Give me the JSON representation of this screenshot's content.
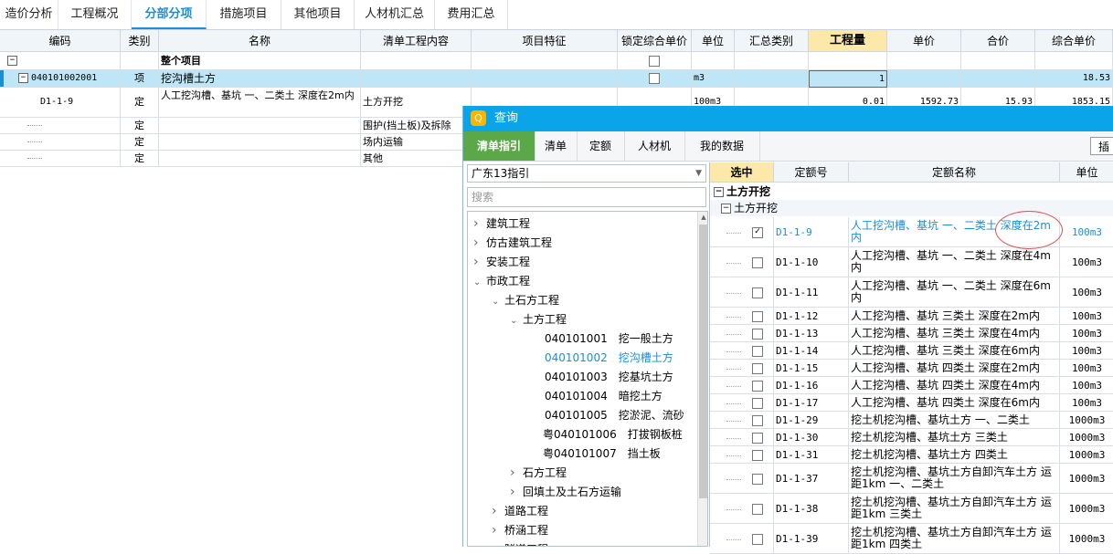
{
  "tabs": [
    "造价分析",
    "工程概况",
    "分部分项",
    "措施项目",
    "其他项目",
    "人材机汇总",
    "费用汇总"
  ],
  "active_tab": "分部分项",
  "main_headers": [
    "编码",
    "类别",
    "名称",
    "清单工程内容",
    "项目特征",
    "锁定综合单价",
    "单位",
    "汇总类别",
    "工程量",
    "单价",
    "合价",
    "综合单价"
  ],
  "main_rows": [
    {
      "code": "",
      "type": "",
      "name": "整个项目",
      "content": "",
      "feature": "",
      "unit": "",
      "summary": "",
      "qty": "",
      "price": "",
      "total": "",
      "unit_total": ""
    },
    {
      "code": "040101002001",
      "type": "项",
      "name": "挖沟槽土方",
      "content": "",
      "feature": "",
      "unit": "m3",
      "summary": "",
      "qty": "1",
      "price": "",
      "total": "",
      "unit_total": "18.53"
    },
    {
      "code": "D1-1-9",
      "type": "定",
      "name": "人工挖沟槽、基坑 一、二类土 深度在2m内",
      "content": "土方开挖",
      "feature": "",
      "unit": "100m3",
      "summary": "",
      "qty": "0.01",
      "price": "1592.73",
      "total": "15.93",
      "unit_total": "1853.15"
    },
    {
      "code": "",
      "type": "定",
      "name": "",
      "content": "围护(挡土板)及拆除",
      "feature": "",
      "unit": "",
      "summary": "",
      "qty": "",
      "price": "",
      "total": "",
      "unit_total": ""
    },
    {
      "code": "",
      "type": "定",
      "name": "",
      "content": "场内运输",
      "feature": "",
      "unit": "",
      "summary": "",
      "qty": "",
      "price": "",
      "total": "",
      "unit_total": ""
    },
    {
      "code": "",
      "type": "定",
      "name": "",
      "content": "其他",
      "feature": "",
      "unit": "",
      "summary": "",
      "qty": "",
      "price": "",
      "total": "",
      "unit_total": ""
    }
  ],
  "dialog": {
    "title": "查询",
    "tabs": [
      "清单指引",
      "清单",
      "定额",
      "人材机",
      "我的数据"
    ],
    "active_tab": "清单指引",
    "region": "广东13指引",
    "search_placeholder": "搜索",
    "tree": [
      {
        "label": "建筑工程",
        "level": 0,
        "arrow": "right"
      },
      {
        "label": "仿古建筑工程",
        "level": 0,
        "arrow": "right"
      },
      {
        "label": "安装工程",
        "level": 0,
        "arrow": "right"
      },
      {
        "label": "市政工程",
        "level": 0,
        "arrow": "down"
      },
      {
        "label": "土石方工程",
        "level": 1,
        "arrow": "down"
      },
      {
        "label": "土方工程",
        "level": 2,
        "arrow": "down"
      },
      {
        "label": "040101001　挖一般土方",
        "level": 3,
        "arrow": ""
      },
      {
        "label": "040101002　挖沟槽土方",
        "level": 3,
        "arrow": "",
        "selected": true
      },
      {
        "label": "040101003　挖基坑土方",
        "level": 3,
        "arrow": ""
      },
      {
        "label": "040101004　暗挖土方",
        "level": 3,
        "arrow": ""
      },
      {
        "label": "040101005　挖淤泥、流砂",
        "level": 3,
        "arrow": ""
      },
      {
        "label": "粤040101006　打拔钢板桩",
        "level": 3,
        "arrow": "",
        "shift": true
      },
      {
        "label": "粤040101007　挡土板",
        "level": 3,
        "arrow": "",
        "shift": true
      },
      {
        "label": "石方工程",
        "level": 2,
        "arrow": "right"
      },
      {
        "label": "回填土及土石方运输",
        "level": 2,
        "arrow": "right"
      },
      {
        "label": "道路工程",
        "level": 1,
        "arrow": "right"
      },
      {
        "label": "桥涵工程",
        "level": 1,
        "arrow": "right"
      },
      {
        "label": "隧道工程",
        "level": 1,
        "arrow": "right"
      }
    ],
    "right_headers": [
      "选中",
      "定额号",
      "定额名称",
      "单位"
    ],
    "group1": "土方开挖",
    "group2": "土方开挖",
    "quota_rows": [
      {
        "code": "D1-1-9",
        "name": "人工挖沟槽、基坑 一、二类土 深度在2m内",
        "unit": "100m3",
        "checked": true,
        "tall": true
      },
      {
        "code": "D1-1-10",
        "name": "人工挖沟槽、基坑 一、二类土 深度在4m内",
        "unit": "100m3",
        "tall": true
      },
      {
        "code": "D1-1-11",
        "name": "人工挖沟槽、基坑 一、二类土 深度在6m内",
        "unit": "100m3",
        "tall": true
      },
      {
        "code": "D1-1-12",
        "name": "人工挖沟槽、基坑 三类土 深度在2m内",
        "unit": "100m3"
      },
      {
        "code": "D1-1-13",
        "name": "人工挖沟槽、基坑 三类土 深度在4m内",
        "unit": "100m3"
      },
      {
        "code": "D1-1-14",
        "name": "人工挖沟槽、基坑 三类土 深度在6m内",
        "unit": "100m3"
      },
      {
        "code": "D1-1-15",
        "name": "人工挖沟槽、基坑 四类土 深度在2m内",
        "unit": "100m3"
      },
      {
        "code": "D1-1-16",
        "name": "人工挖沟槽、基坑 四类土 深度在4m内",
        "unit": "100m3"
      },
      {
        "code": "D1-1-17",
        "name": "人工挖沟槽、基坑 四类土 深度在6m内",
        "unit": "100m3"
      },
      {
        "code": "D1-1-29",
        "name": "挖土机挖沟槽、基坑土方 一、二类土",
        "unit": "1000m3"
      },
      {
        "code": "D1-1-30",
        "name": "挖土机挖沟槽、基坑土方 三类土",
        "unit": "1000m3"
      },
      {
        "code": "D1-1-31",
        "name": "挖土机挖沟槽、基坑土方 四类土",
        "unit": "1000m3"
      },
      {
        "code": "D1-1-37",
        "name": "挖土机挖沟槽、基坑土方自卸汽车土方 运距1km 一、二类土",
        "unit": "1000m3",
        "tall": true
      },
      {
        "code": "D1-1-38",
        "name": "挖土机挖沟槽、基坑土方自卸汽车土方 运距1km 三类土",
        "unit": "1000m3",
        "tall": true
      },
      {
        "code": "D1-1-39",
        "name": "挖土机挖沟槽、基坑土方自卸汽车土方 运距1km 四类土",
        "unit": "1000m3",
        "tall": true
      }
    ],
    "side_button": "插",
    "colors": {
      "title_bar": "#0aa4e8",
      "active_tab": "#5aa847",
      "link": "#1a8fd6"
    }
  }
}
